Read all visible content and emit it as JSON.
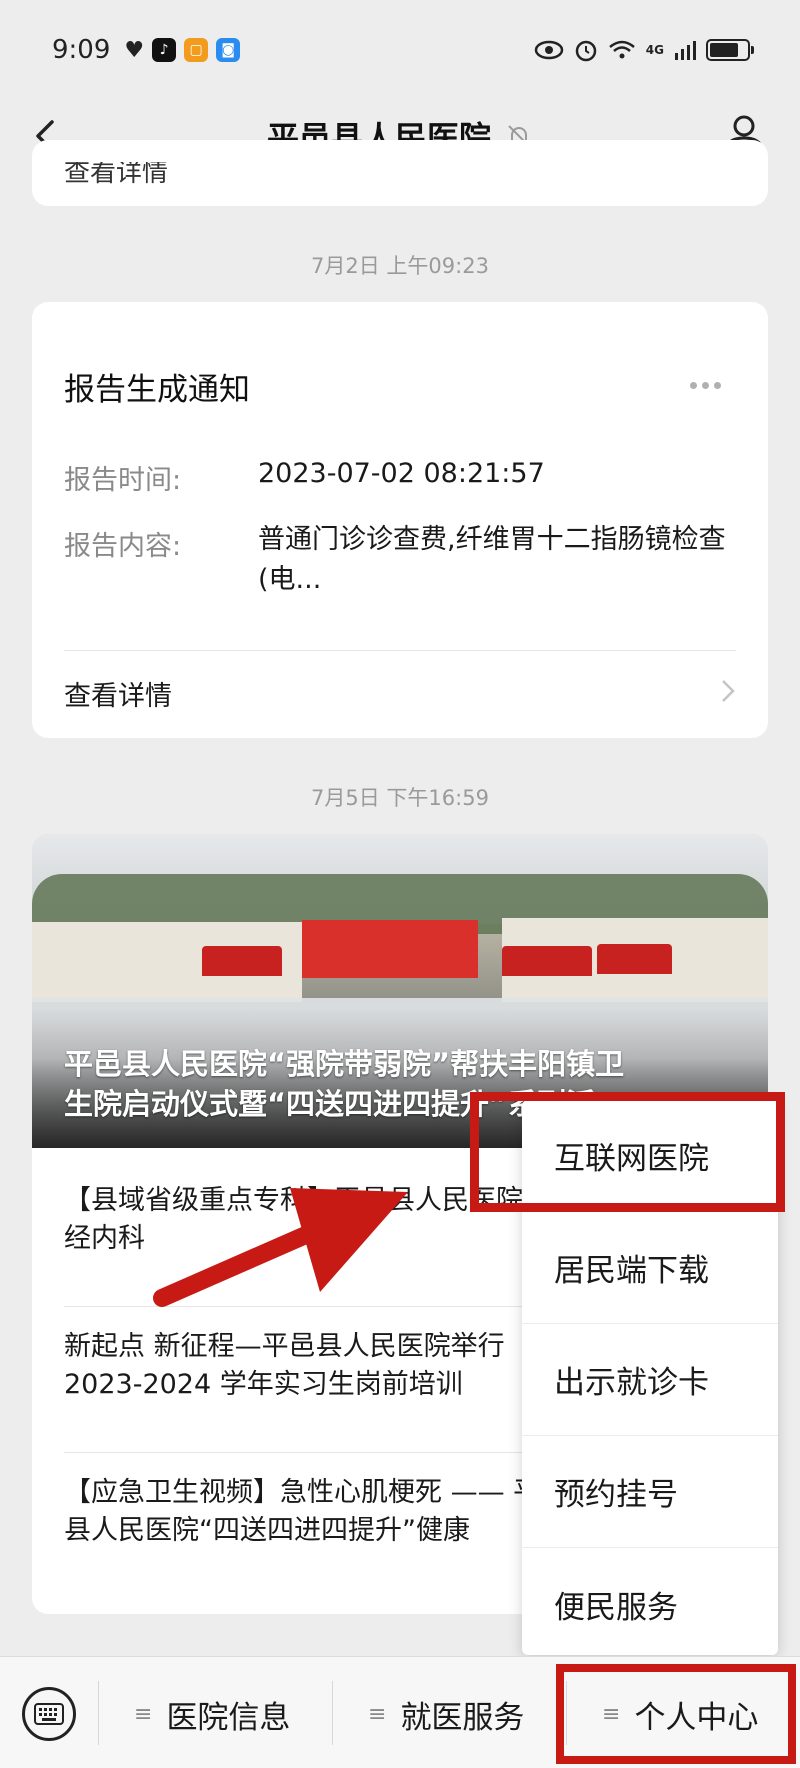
{
  "status_bar": {
    "time": "9:09",
    "network_label": "4G"
  },
  "header": {
    "title": "平邑县人民医院"
  },
  "messages": {
    "partial_card_text": "查看详情",
    "timestamp_1": "7月2日 上午09:23",
    "report_card": {
      "title": "报告生成通知",
      "time_label": "报告时间:",
      "time_value": "2023-07-02 08:21:57",
      "content_label": "报告内容:",
      "content_value": "普通门诊诊查费,纤维胃十二指肠镜检查 (电...",
      "details_label": "查看详情"
    },
    "timestamp_2": "7月5日 下午16:59",
    "news_card": {
      "lead_caption": "平邑县人民医院“强院带弱院”帮扶丰阳镇卫\n生院启动仪式暨“四送四进四提升”系列活",
      "items": [
        "【县域省级重点专科】平邑县人民医院神\n经内科",
        "新起点 新征程—平邑县人民医院举行\n2023-2024 学年实习生岗前培训",
        "【应急卫生视频】急性心肌梗死 —— 平邑\n县人民医院“四送四进四提升”健康"
      ]
    }
  },
  "popup_menu": {
    "items": [
      "互联网医院",
      "居民端下载",
      "出示就诊卡",
      "预约挂号",
      "便民服务"
    ]
  },
  "bottom_bar": {
    "tabs": [
      "医院信息",
      "就医服务",
      "个人中心"
    ]
  },
  "colors": {
    "highlight": "#c81a14",
    "background": "#ededed"
  }
}
